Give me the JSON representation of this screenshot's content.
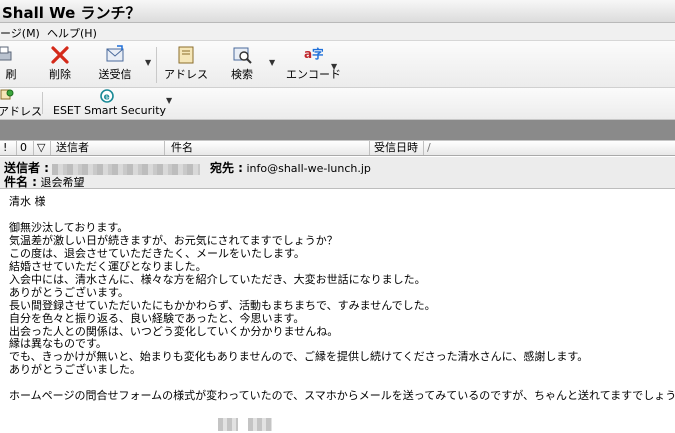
{
  "window": {
    "title": "Shall We ランチ？"
  },
  "menu": [
    {
      "label": "ージ(M)"
    },
    {
      "label": "ヘルプ(H)"
    }
  ],
  "toolbar": [
    {
      "label": "刷",
      "icon": "print-icon"
    },
    {
      "label": "削除",
      "icon": "delete-icon"
    },
    {
      "label": "送受信",
      "icon": "send-receive-icon"
    },
    {
      "label": "アドレス",
      "icon": "address-book-icon"
    },
    {
      "label": "検索",
      "icon": "search-icon"
    },
    {
      "label": "エンコード",
      "icon": "encoding-icon"
    }
  ],
  "toolbar2": [
    {
      "label": "アドレス",
      "icon": "address-icon"
    },
    {
      "label": "ESET Smart Security",
      "icon": "eset-icon"
    }
  ],
  "columns": {
    "priority": "!",
    "attachment": "0",
    "flag": "▽",
    "from": "送信者",
    "subject": "件名",
    "received": "受信日時",
    "sort": "/"
  },
  "message": {
    "from_label": "送信者 :",
    "to_label": "宛先 :",
    "to_value": "info@shall-we-lunch.jp",
    "subject_label": "件名 :",
    "subject_value": "退会希望",
    "body": "清水 様\n\n御無沙汰しております。\n気温差が激しい日が続きますが、お元気にされてますでしょうか？\nこの度は、退会させていただきたく、メールをいたします。\n結婚させていただく運びとなりました。\n入会中には、清水さんに、様々な方を紹介していただき、大変お世話になりました。\nありがとうございます。\n長い間登録させていただいたにもかかわらず、活動もまちまちで、すみませんでした。\n自分を色々と振り返る、良い経験であったと、今思います。\n出会った人との関係は、いつどう変化していくか分かりませんね。\n縁は異なものです。\nでも、きっかけが無いと、始まりも変化もありませんので、ご縁を提供し続けてくださった清水さんに、感謝します。\nありがとうございました。\n\nホームページの問合せフォームの様式が変わっていたので、スマホからメールを送ってみているのですが、ちゃんと送れてますでしょうか？"
  },
  "colors": {
    "accent": "#1e6fd9",
    "delete": "#d42a1a",
    "eset": "#1b8a96"
  }
}
